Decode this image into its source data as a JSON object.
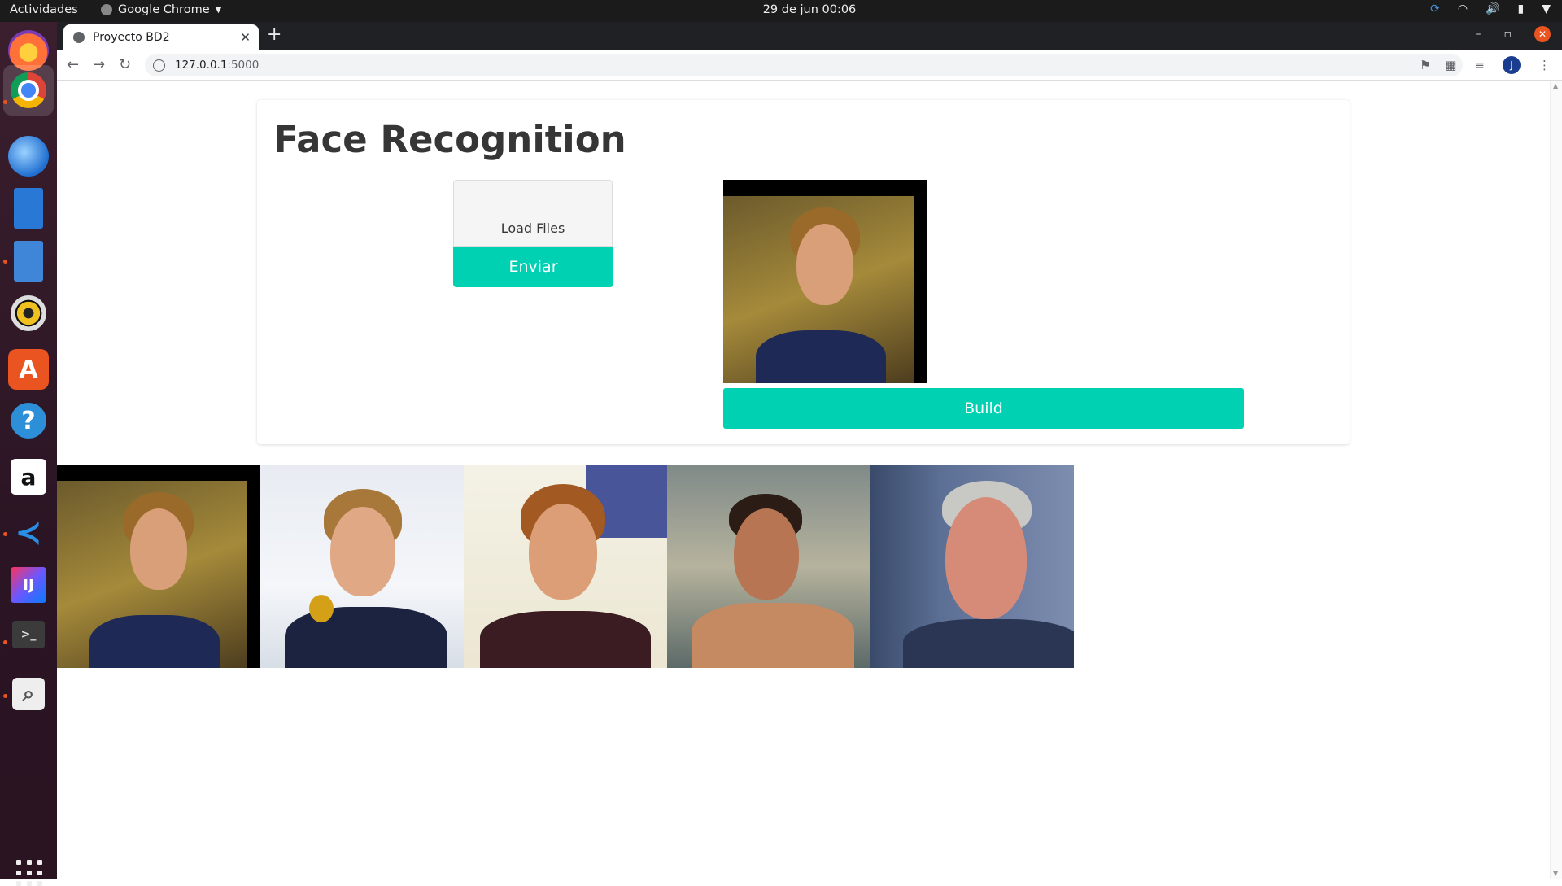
{
  "os": {
    "activities": "Actividades",
    "app_menu": "Google Chrome",
    "clock": "29 de jun  00:06"
  },
  "dock": {
    "apps": [
      "firefox",
      "chrome",
      "thunderbird",
      "libreoffice-writer",
      "files",
      "rhythmbox",
      "ubuntu-software",
      "help",
      "amazon",
      "vscode",
      "intellij",
      "terminal",
      "image-viewer"
    ]
  },
  "browser": {
    "tab_title": "Proyecto BD2",
    "url_host": "127.0.0.1",
    "url_port": ":5000",
    "profile_initial": "J"
  },
  "page": {
    "title": "Face Recognition",
    "load_files_label": "Load Files",
    "enviar_label": "Enviar",
    "build_label": "Build",
    "result_count": 5
  },
  "colors": {
    "accent": "#00d1b2",
    "title": "#363636",
    "ubuntu_orange": "#e95420"
  }
}
